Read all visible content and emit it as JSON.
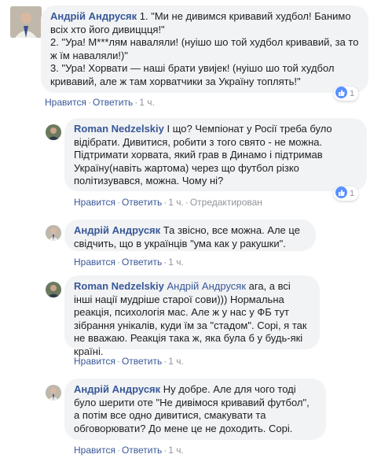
{
  "comments": [
    {
      "author": "Андрій Андрусяк",
      "text": " 1. \"Ми не дивимся кривавий худбол! Банимо всіх хто його дивиццця!\"\n2. \"Ура! М***лям наваляли! (нуішо шо той худбол кривавий, за то ж їм наваляли!)\"\n3. \"Ура! Хорвати — наші брати увиjек! (нуішо шо той худбол кривавий, але ж там хорватчики за Україну топлять!\"",
      "like": "Нравится",
      "reply": "Ответить",
      "time": "1 ч.",
      "reactions": "1"
    },
    {
      "author": "Roman Nedzelskiy",
      "text": " І що? Чемпіонат у Росії треба було відібрати. Дивитися, робити з того свято - не можна. Підтримати хорвата, який грав в Динамо і підтримав Україну(навіть жартома) через що футбол різко політизувався, можна. Чому ні?",
      "like": "Нравится",
      "reply": "Ответить",
      "time": "1 ч.",
      "edited": "Отредактирован",
      "reactions": "1"
    },
    {
      "author": "Андрій Андрусяк",
      "text": " Та звісно, все можна. Але це свідчить, що в українців \"ума как у ракушки\".",
      "like": "Нравится",
      "reply": "Ответить",
      "time": "1 ч."
    },
    {
      "author": "Roman Nedzelskiy",
      "mention": "Андрій Андрусяк",
      "text": " ага, а всі інші нації мудріше старої сови))) Нормальна реакція, психологія мас. Але ж у нас у ФБ тут зібрання унікалів, куди їм за \"стадом\". Сорі, я так не вважаю. Реакція така ж, яка була б у будь-які країні.",
      "like": "Нравится",
      "reply": "Ответить",
      "time": "1 ч."
    },
    {
      "author": "Андрій Андрусяк",
      "text": " Ну добре. Але для чого тоді було шерити оте \"Не дивімося кривавий футбол\", а потім все одно дивитися, смакувати та обговорювати? До мене це не доходить. Сорі.",
      "like": "Нравится",
      "reply": "Ответить",
      "time": "1 ч."
    }
  ],
  "colors": {
    "link": "#385898",
    "muted": "#90949c",
    "bubble": "#f2f3f5",
    "like": "#5890ff"
  }
}
